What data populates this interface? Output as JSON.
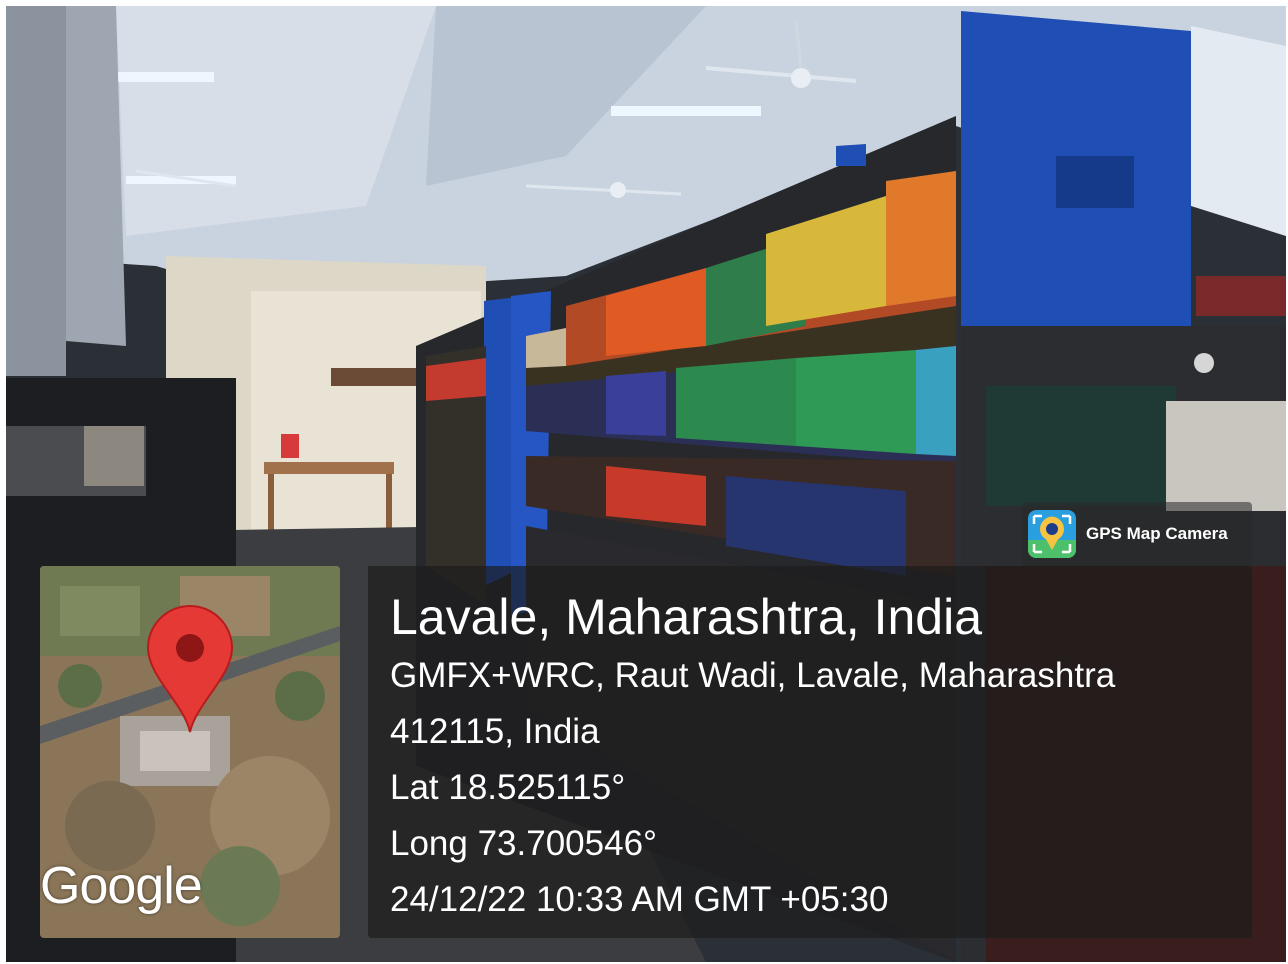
{
  "badge": {
    "label": "GPS Map Camera",
    "icon": "map-pin-camera-icon"
  },
  "map": {
    "logo_text": "Google",
    "marker_color": "#e53935",
    "marker_icon": "map-marker-icon"
  },
  "info": {
    "title": "Lavale, Maharashtra, India",
    "address": "GMFX+WRC, Raut Wadi, Lavale, Maharashtra 412115, India",
    "lat": "Lat 18.525115°",
    "long": "Long 73.700546°",
    "datetime": "24/12/22 10:33 AM GMT +05:30"
  },
  "colors": {
    "shelf_blue": "#1f4fb5",
    "panel_bg": "#1c1c1c",
    "text": "#ffffff"
  }
}
